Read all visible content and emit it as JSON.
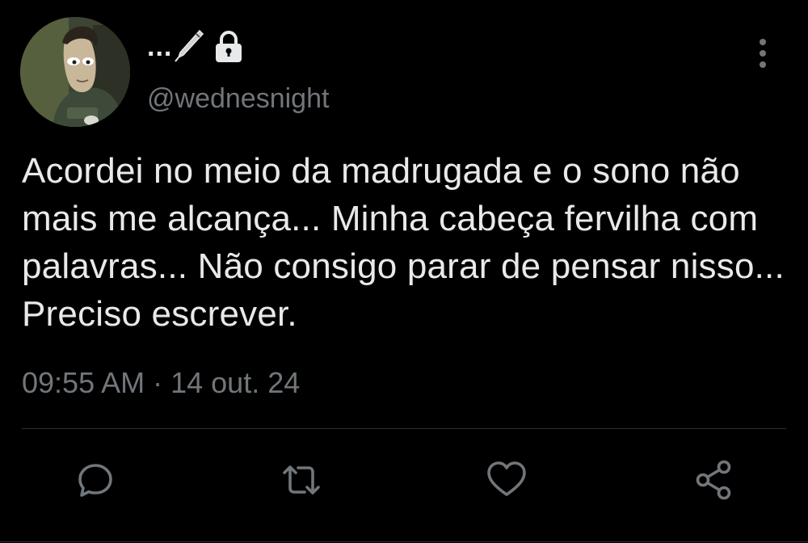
{
  "tweet": {
    "display_name": "...",
    "handle": "@wednesnight",
    "text": "Acordei no meio da madrugada e o sono não mais me alcança... Minha cabeça fervilha com palavras... Não consigo parar de pensar nisso... Preciso escrever.",
    "time": "09:55 AM",
    "separator": "·",
    "date": "14 out. 24"
  },
  "icons": {
    "name_emoji": "pen-icon",
    "protected": "lock-icon",
    "more": "more-vertical-icon",
    "reply": "reply-icon",
    "retweet": "retweet-icon",
    "like": "heart-icon",
    "share": "share-icon"
  },
  "colors": {
    "background": "#000000",
    "text": "#e7e9ea",
    "secondary": "#71767b",
    "divider": "#2f3336"
  }
}
